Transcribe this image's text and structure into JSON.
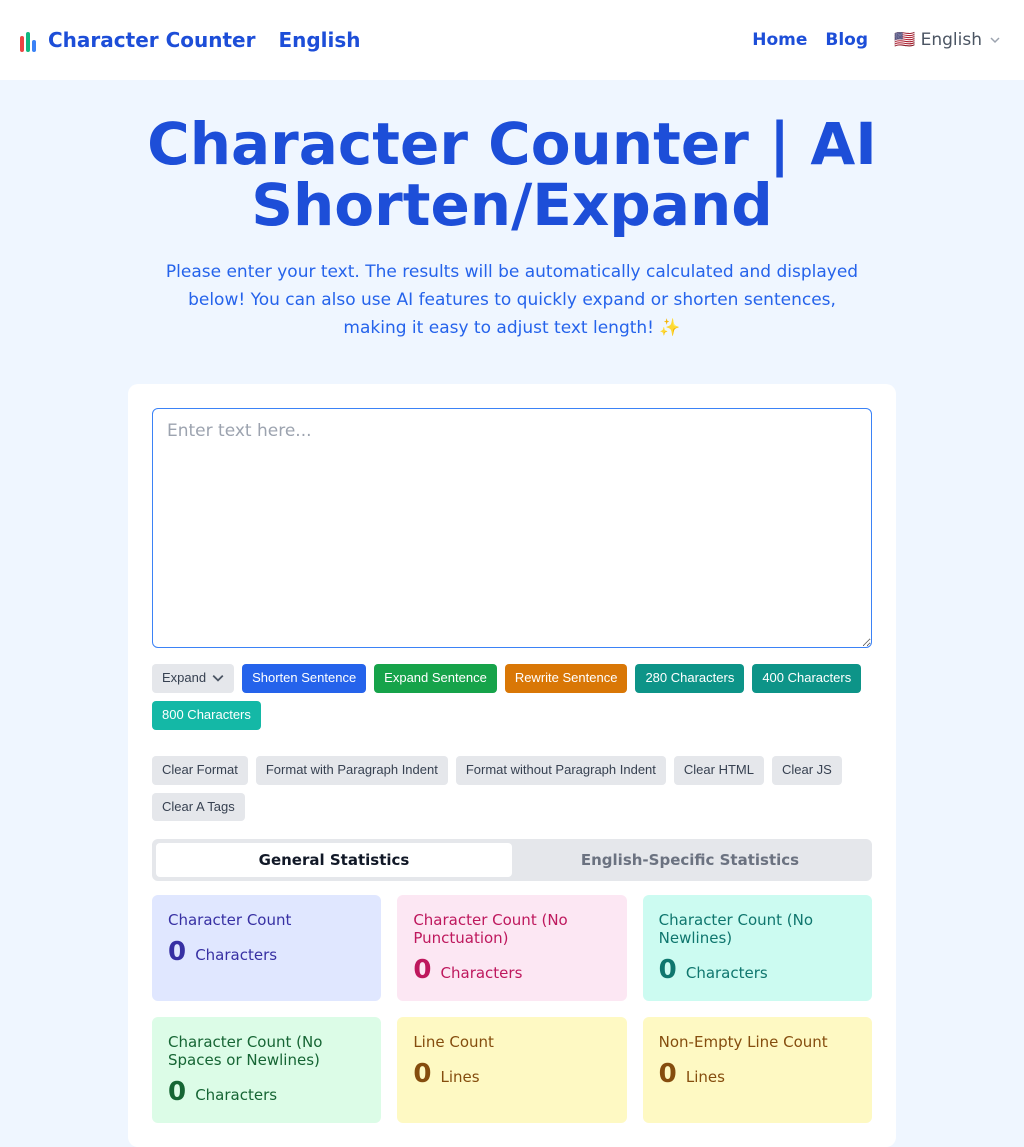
{
  "header": {
    "brand_a": "Character Counter",
    "brand_b": "English",
    "nav": {
      "home": "Home",
      "blog": "Blog",
      "lang": "🇺🇸 English"
    }
  },
  "hero": {
    "title": "Character Counter | AI Shorten/Expand",
    "subtitle": "Please enter your text. The results will be automatically calculated and displayed below! You can also use AI features to quickly expand or shorten sentences, making it easy to adjust text length! ✨"
  },
  "textarea": {
    "placeholder": "Enter text here..."
  },
  "ai_buttons": {
    "expand_menu": "Expand",
    "shorten": "Shorten Sentence",
    "expand": "Expand Sentence",
    "rewrite": "Rewrite Sentence",
    "c280": "280 Characters",
    "c400": "400 Characters",
    "c800": "800 Characters"
  },
  "format_buttons": {
    "clear_format": "Clear Format",
    "with_indent": "Format with Paragraph Indent",
    "without_indent": "Format without Paragraph Indent",
    "clear_html": "Clear HTML",
    "clear_js": "Clear JS",
    "clear_a": "Clear A Tags"
  },
  "tabs": {
    "general": "General Statistics",
    "english": "English-Specific Statistics"
  },
  "stats": {
    "s1": {
      "label": "Character Count",
      "value": "0",
      "unit": "Characters"
    },
    "s2": {
      "label": "Character Count (No Punctuation)",
      "value": "0",
      "unit": "Characters"
    },
    "s3": {
      "label": "Character Count (No Newlines)",
      "value": "0",
      "unit": "Characters"
    },
    "s4": {
      "label": "Character Count (No Spaces or Newlines)",
      "value": "0",
      "unit": "Characters"
    },
    "s5": {
      "label": "Line Count",
      "value": "0",
      "unit": "Lines"
    },
    "s6": {
      "label": "Non-Empty Line Count",
      "value": "0",
      "unit": "Lines"
    }
  }
}
